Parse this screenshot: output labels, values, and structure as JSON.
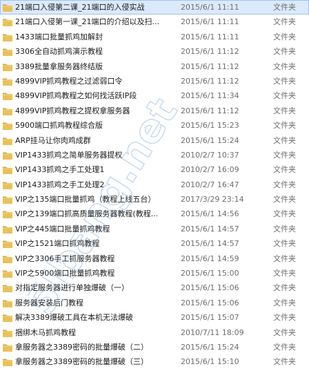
{
  "files": [
    {
      "name": "21端口入侵第二课_21端口的入侵实战",
      "date": "2015/6/1 11:11",
      "type": "文件夹",
      "selected": true
    },
    {
      "name": "21端口入侵第一课_21端口的介绍以及扫...",
      "date": "2015/6/1 11:11",
      "type": "文件夹"
    },
    {
      "name": "1433端口批量抓鸡加解封",
      "date": "2015/6/1 11:11",
      "type": "文件夹"
    },
    {
      "name": "3306全自动抓鸡演示教程",
      "date": "2015/6/1 11:12",
      "type": "文件夹"
    },
    {
      "name": "3389批量拿服务器终结版",
      "date": "2015/6/1 11:12",
      "type": "文件夹"
    },
    {
      "name": "4899VIP抓鸡教程之过滤弱口令",
      "date": "2015/6/1 11:12",
      "type": "文件夹"
    },
    {
      "name": "4899VIP抓鸡教程之如何找活跃IP段",
      "date": "2015/6/1 11:34",
      "type": "文件夹"
    },
    {
      "name": "4899VIP抓鸡教程之提权拿服务器",
      "date": "2015/6/1 11:12",
      "type": "文件夹"
    },
    {
      "name": "5900端口抓鸡教程综合版",
      "date": "2015/6/1 15:23",
      "type": "文件夹"
    },
    {
      "name": "ARP挂马让你肉鸡成群",
      "date": "2015/6/1 15:24",
      "type": "文件夹"
    },
    {
      "name": "VIP1433抓鸡之简单服务器提权",
      "date": "2010/2/7 10:37",
      "type": "文件夹"
    },
    {
      "name": "VIP1433抓鸡之手工处理1",
      "date": "2010/2/7 16:09",
      "type": "文件夹"
    },
    {
      "name": "VIP1433抓鸡之手工处理2",
      "date": "2010/2/7 16:47",
      "type": "文件夹"
    },
    {
      "name": "VIP之135端口批量抓鸡（教程上线五台）",
      "date": "2017/3/29 23:14",
      "type": "文件夹"
    },
    {
      "name": "VIP之139端口抓高质量服务器教程(教程...",
      "date": "2015/6/1 14:56",
      "type": "文件夹"
    },
    {
      "name": "VIP之445端口批量抓鸡教程",
      "date": "2015/6/1 14:57",
      "type": "文件夹"
    },
    {
      "name": "VIP之1521端口抓鸡教程",
      "date": "2015/6/1 14:57",
      "type": "文件夹"
    },
    {
      "name": "VIP之3306手工抓服务器教程",
      "date": "2015/6/1 14:59",
      "type": "文件夹"
    },
    {
      "name": "VIP之5900端口批量抓鸡教程",
      "date": "2015/6/1 15:00",
      "type": "文件夹"
    },
    {
      "name": "对指定服务器进行单独爆破（一）",
      "date": "2015/6/1 15:06",
      "type": "文件夹"
    },
    {
      "name": "服务器安装后门教程",
      "date": "2015/6/1 15:06",
      "type": "文件夹"
    },
    {
      "name": "解决3389爆破工具在本机无法爆破",
      "date": "2015/6/1 15:07",
      "type": "文件夹"
    },
    {
      "name": "捆绑木马抓鸡教程",
      "date": "2010/7/11 18:09",
      "type": "文件夹"
    },
    {
      "name": "拿服务器之3389密码的批量爆破（二）",
      "date": "2015/6/1 15:24",
      "type": "文件夹"
    },
    {
      "name": "拿服务器之3389密码的批量爆破（三）",
      "date": "2015/6/1 15:10",
      "type": "文件夹"
    }
  ],
  "watermark": {
    "text": "5Ibang.net"
  },
  "colors": {
    "selection_bg": "#dbe9fb",
    "selection_border": "#9ec3ef",
    "folder_body": "#e8c15a",
    "folder_tab": "#d9a93a",
    "secondary_text": "#6d6d6d"
  },
  "icons": {
    "folder": "folder-icon"
  }
}
